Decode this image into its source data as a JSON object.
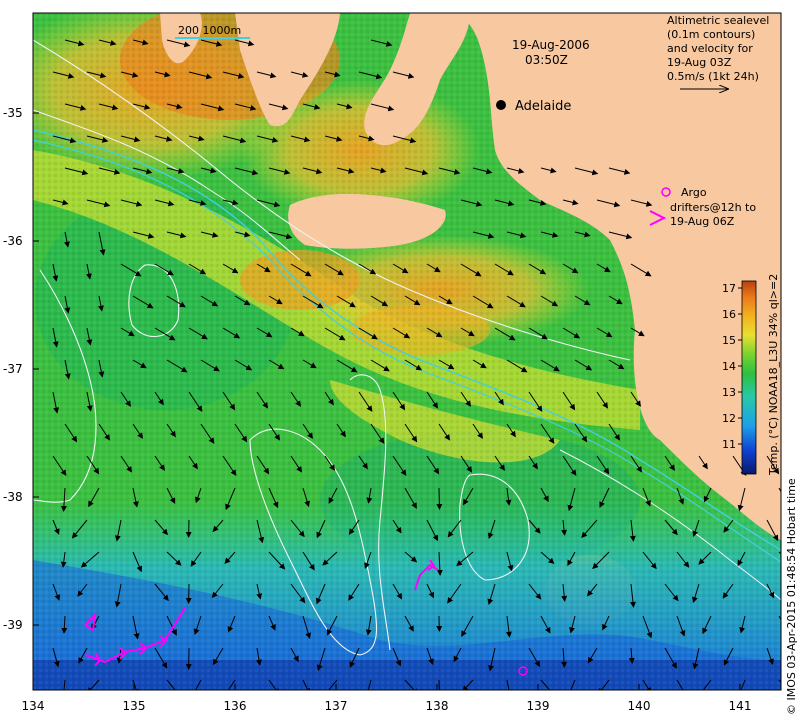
{
  "header": {
    "date": "19-Aug-2006",
    "time": "03:50Z"
  },
  "scale_bar": {
    "label": "200  1000m"
  },
  "legend": {
    "line1": "Altimetric sealevel",
    "line2": "(0.1m contours)",
    "line3": "and velocity for",
    "line4": "19-Aug 03Z",
    "line5": "0.5m/s (1kt 24h)"
  },
  "argo": {
    "line1": "Argo",
    "line2": "drifters@12h to",
    "line3": "19-Aug 06Z",
    "color": "#ff00ff"
  },
  "city": {
    "name": "Adelaide"
  },
  "colorbar": {
    "label": "Temp. (°C) NOAA18_L3U 34% ql>=2",
    "ticks": [
      "11",
      "12",
      "13",
      "14",
      "15",
      "16",
      "17"
    ],
    "colors": [
      "#081a6e",
      "#1040d0",
      "#1ea0e8",
      "#28c8a8",
      "#2cc040",
      "#7cd230",
      "#e8e030",
      "#f4b020",
      "#e87818",
      "#b84010"
    ]
  },
  "credit": {
    "text": "© IMOS 03-Apr-2015 01:48:54 Hobart time"
  },
  "axes": {
    "x_ticks": [
      "134",
      "135",
      "136",
      "137",
      "138",
      "139",
      "140",
      "141"
    ],
    "y_ticks": [
      "-35",
      "-36",
      "-37",
      "-38",
      "-39"
    ]
  },
  "colors": {
    "land": "#f8c8a0",
    "contour": "#e8f0f0",
    "isobath": "#40d0e0"
  }
}
